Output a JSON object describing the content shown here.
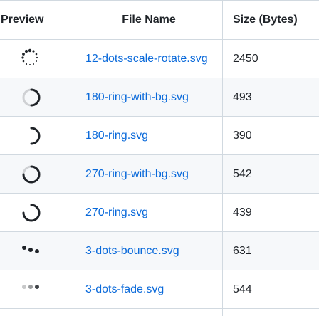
{
  "table": {
    "headers": {
      "preview": "Preview",
      "file_name": "File Name",
      "size": "Size (Bytes)"
    },
    "rows": [
      {
        "icon": "12-dots-scale-rotate-icon",
        "file_name": "12-dots-scale-rotate.svg",
        "size": "2450"
      },
      {
        "icon": "180-ring-with-bg-icon",
        "file_name": "180-ring-with-bg.svg",
        "size": "493"
      },
      {
        "icon": "180-ring-icon",
        "file_name": "180-ring.svg",
        "size": "390"
      },
      {
        "icon": "270-ring-with-bg-icon",
        "file_name": "270-ring-with-bg.svg",
        "size": "542"
      },
      {
        "icon": "270-ring-icon",
        "file_name": "270-ring.svg",
        "size": "439"
      },
      {
        "icon": "3-dots-bounce-icon",
        "file_name": "3-dots-bounce.svg",
        "size": "631"
      },
      {
        "icon": "3-dots-fade-icon",
        "file_name": "3-dots-fade.svg",
        "size": "544"
      }
    ]
  },
  "colors": {
    "link": "#0969da",
    "border": "#d1d9e0",
    "stripe": "#f6f8fa",
    "text": "#1f2328"
  }
}
